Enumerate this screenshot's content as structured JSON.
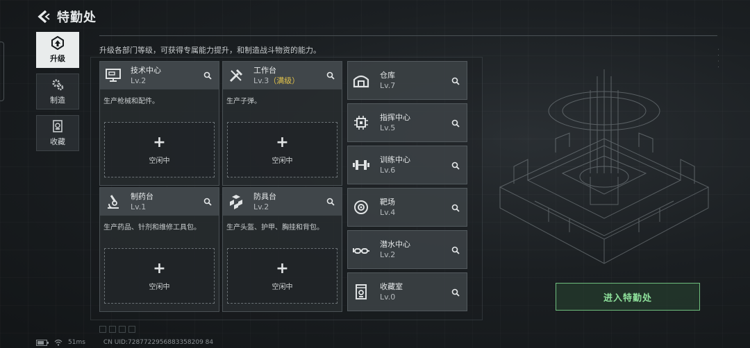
{
  "header": {
    "title": "特勤处"
  },
  "side_tabs": [
    {
      "label": "升级",
      "icon": "upgrade-icon",
      "active": true
    },
    {
      "label": "制造",
      "icon": "gears-icon",
      "active": false
    },
    {
      "label": "收藏",
      "icon": "collection-icon",
      "active": false
    }
  ],
  "subtitle": "升级各部门等级，可获得专属能力提升，和制造战斗物资的能力。",
  "cards": [
    {
      "name": "技术中心",
      "level": "Lv.2",
      "desc": "生产枪械和配件。",
      "slot_label": "空闲中"
    },
    {
      "name": "工作台",
      "level": "Lv.3",
      "level_extra": "（满级）",
      "desc": "生产子弹。",
      "slot_label": "空闲中"
    },
    {
      "name": "制药台",
      "level": "Lv.1",
      "desc": "生产药品、针剂和维修工具包。",
      "slot_label": "空闲中"
    },
    {
      "name": "防具台",
      "level": "Lv.2",
      "desc": "生产头盔、护甲、胸挂和背包。",
      "slot_label": "空闲中"
    }
  ],
  "facilities": [
    {
      "name": "仓库",
      "level": "Lv.7"
    },
    {
      "name": "指挥中心",
      "level": "Lv.5"
    },
    {
      "name": "训练中心",
      "level": "Lv.6"
    },
    {
      "name": "靶场",
      "level": "Lv.4"
    },
    {
      "name": "潜水中心",
      "level": "Lv.2"
    },
    {
      "name": "收藏室",
      "level": "Lv.0"
    }
  ],
  "enter_button": "进入特勤处",
  "status": {
    "ping": "51ms",
    "uid": "CN UID:7287722956883358209 84"
  },
  "colors": {
    "accent_green": "#8fe29c",
    "max_level": "#e2c34a"
  }
}
